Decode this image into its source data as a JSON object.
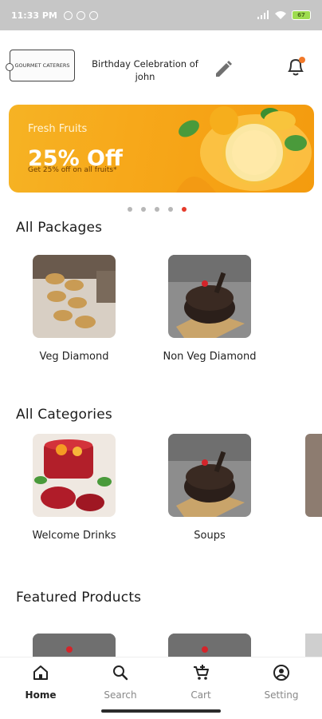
{
  "status_bar": {
    "time": "11:33 PM",
    "battery": "67",
    "icons": [
      "alarm-icon",
      "whatsapp-icon",
      "vpn-icon",
      "signal-icon",
      "wifi-icon",
      "battery-icon"
    ]
  },
  "header": {
    "logo_text": "GOURMET CATERERS",
    "event_title": "Birthday Celebration of john",
    "icons": [
      "pencil-icon",
      "bell-icon"
    ]
  },
  "banner": {
    "subtitle": "Fresh Fruits",
    "title": "25% Off",
    "description": "Get 25% off on all fruits*",
    "slides": 5,
    "active_slide": 5
  },
  "sections": {
    "packages": {
      "title": "All Packages",
      "items": [
        {
          "label": "Veg Diamond",
          "image": "canapes"
        },
        {
          "label": "Non Veg Diamond",
          "image": "chocolate-cake"
        }
      ]
    },
    "categories": {
      "title": "All Categories",
      "items": [
        {
          "label": "Welcome Drinks",
          "image": "fruit-punch"
        },
        {
          "label": "Soups",
          "image": "chocolate-cake"
        }
      ]
    },
    "featured": {
      "title": "Featured Products"
    }
  },
  "bottom_nav": {
    "items": [
      {
        "label": "Home",
        "icon": "home-icon",
        "active": true
      },
      {
        "label": "Search",
        "icon": "search-icon",
        "active": false
      },
      {
        "label": "Cart",
        "icon": "cart-icon",
        "active": false
      },
      {
        "label": "Setting",
        "icon": "user-circle-icon",
        "active": false
      }
    ]
  },
  "colors": {
    "accent": "#e53a2a",
    "banner": "#f6b324",
    "status_bar": "#c6c6c6"
  }
}
